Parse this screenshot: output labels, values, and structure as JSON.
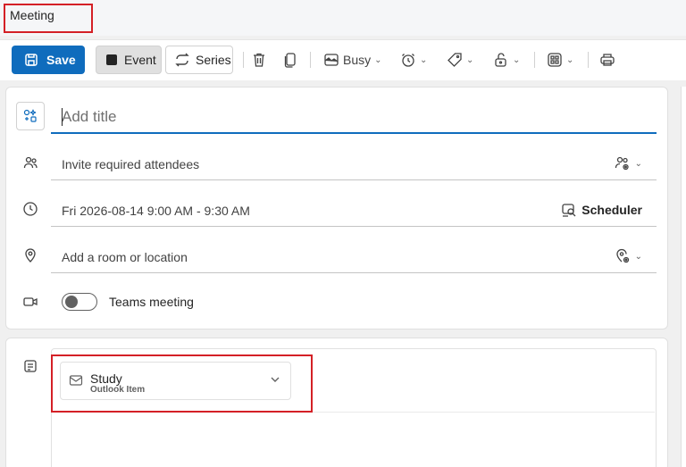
{
  "window": {
    "title": "Meeting"
  },
  "toolbar": {
    "save_label": "Save",
    "event_label": "Event",
    "series_label": "Series",
    "busy_label": "Busy",
    "icons": [
      "delete-icon",
      "copy-icon",
      "busy-icon",
      "reminder-icon",
      "categorize-icon",
      "privacy-icon",
      "apps-icon",
      "print-icon"
    ]
  },
  "form": {
    "title_placeholder": "Add title",
    "attendees_placeholder": "Invite required attendees",
    "datetime": "Fri 2026-08-14 9:00 AM - 9:30 AM",
    "scheduler_label": "Scheduler",
    "location_placeholder": "Add a room or location",
    "teams_label": "Teams meeting",
    "teams_enabled": false
  },
  "attachment": {
    "name": "Study",
    "type": "Outlook Item"
  },
  "colors": {
    "accent": "#0f6cbd",
    "highlight": "#d42026"
  }
}
